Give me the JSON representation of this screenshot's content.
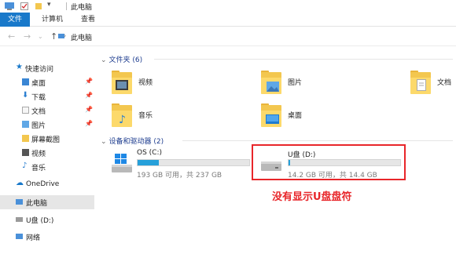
{
  "window": {
    "title": "此电脑"
  },
  "ribbon": {
    "tabs": [
      {
        "label": "文件"
      },
      {
        "label": "计算机"
      },
      {
        "label": "查看"
      }
    ]
  },
  "address": {
    "path": "此电脑"
  },
  "sidebar": {
    "items": [
      {
        "label": "快速访问"
      },
      {
        "label": "桌面"
      },
      {
        "label": "下载"
      },
      {
        "label": "文档"
      },
      {
        "label": "图片"
      },
      {
        "label": "屏幕截图"
      },
      {
        "label": "视频"
      },
      {
        "label": "音乐"
      },
      {
        "label": "OneDrive"
      },
      {
        "label": "此电脑"
      },
      {
        "label": "U盘 (D:)"
      },
      {
        "label": "网络"
      }
    ]
  },
  "folders_group": {
    "header": "文件夹 (6)"
  },
  "folders": [
    {
      "label": "视频"
    },
    {
      "label": "图片"
    },
    {
      "label": "文档"
    },
    {
      "label": "音乐"
    },
    {
      "label": "桌面"
    }
  ],
  "devices_group": {
    "header": "设备和驱动器 (2)"
  },
  "drives": [
    {
      "name": "OS (C:)",
      "caption": "193 GB 可用，共 237 GB",
      "used_fraction": 0.19,
      "bar_color": "#26a0da"
    },
    {
      "name": "U盘 (D:)",
      "caption": "14.2 GB 可用，共 14.4 GB",
      "used_fraction": 0.014,
      "bar_color": "#26a0da"
    }
  ],
  "annotation": {
    "text": "没有显示U盘盘符",
    "color": "#e8262a"
  },
  "colors": {
    "accent": "#1979ca",
    "folder": "#fcd96b",
    "drive_bar": "#26a0da"
  }
}
